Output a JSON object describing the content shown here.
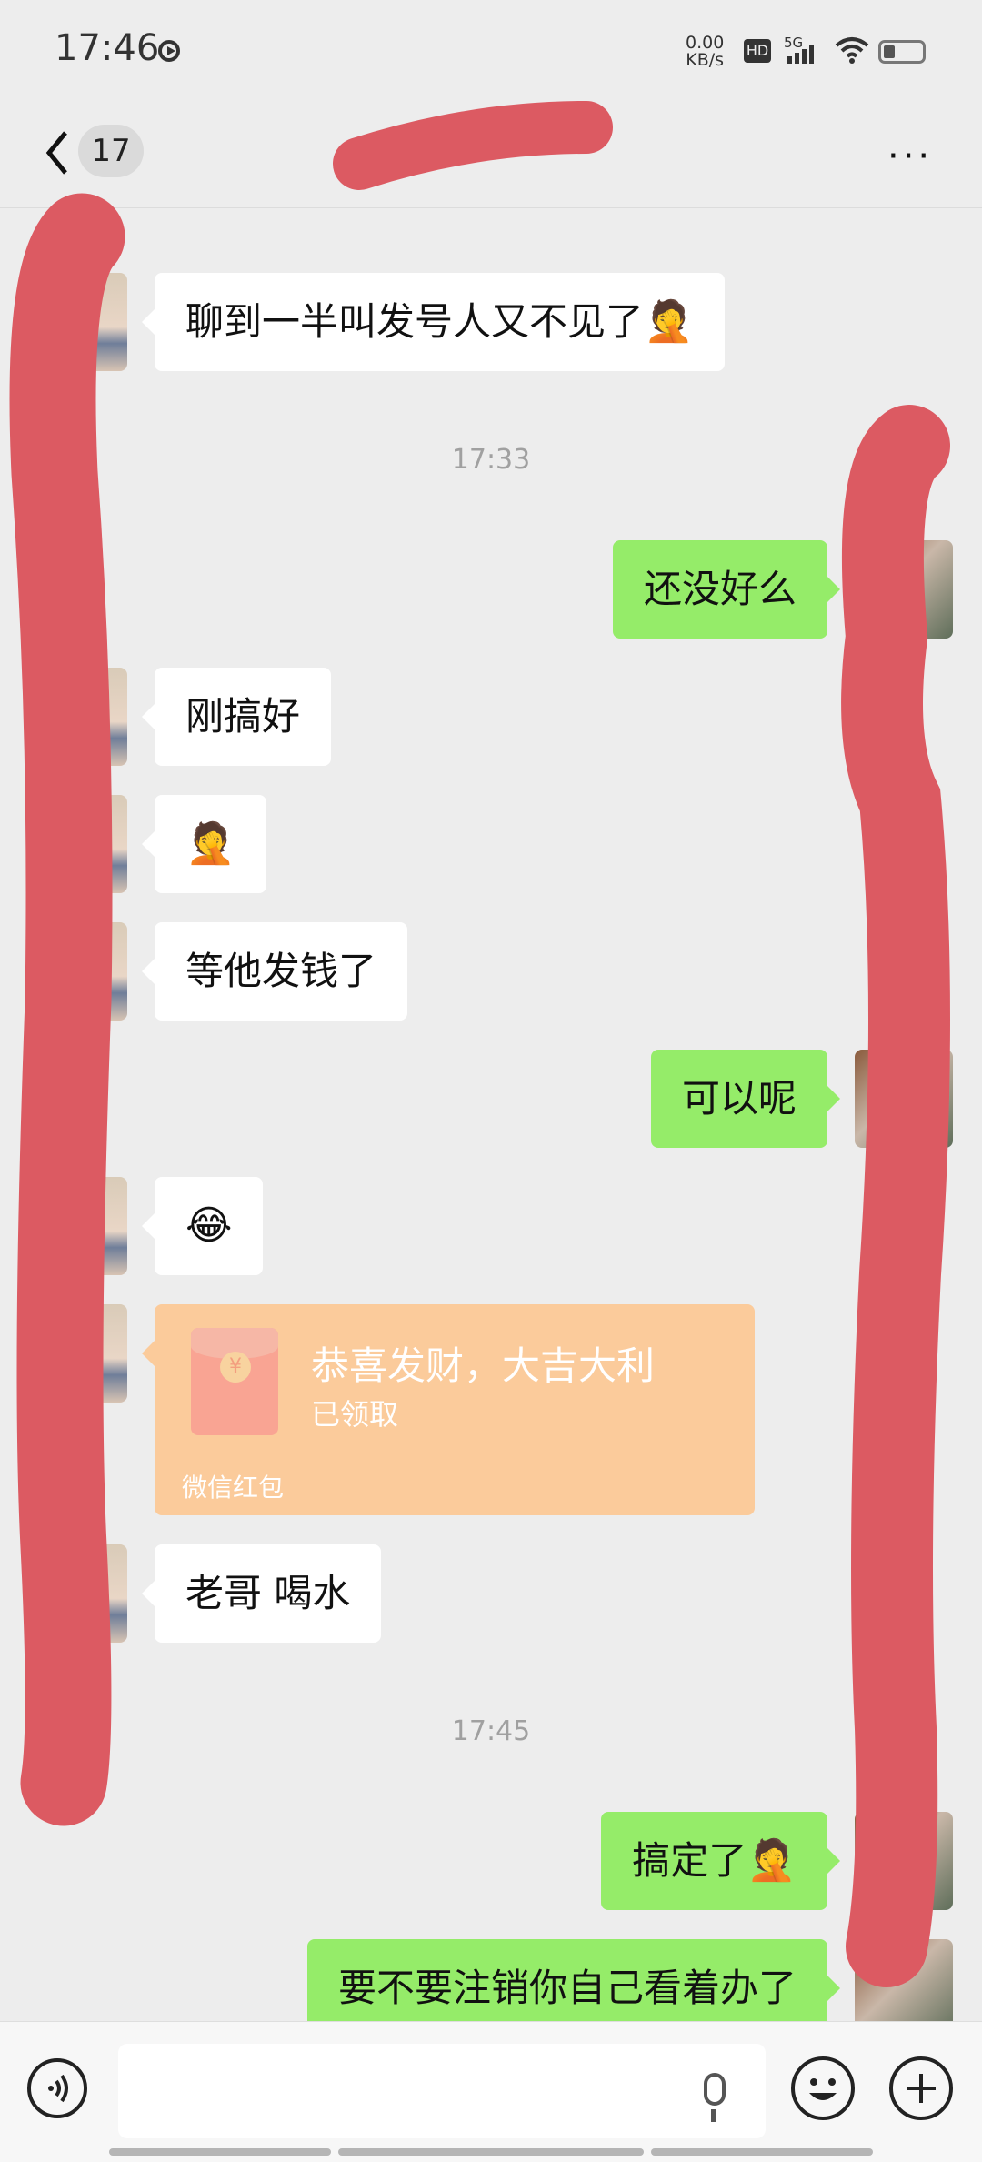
{
  "status_bar": {
    "time": "17:46",
    "net_speed_value": "0.00",
    "net_speed_unit": "KB/s",
    "hd_label": "HD",
    "signal_label": "5G"
  },
  "title_bar": {
    "unread_count": "17"
  },
  "messages": [
    {
      "text": "聊到一半叫发号人又不见了",
      "emoji": "🤦"
    },
    {
      "text": "17:33"
    },
    {
      "text": "还没好么"
    },
    {
      "text": "刚搞好"
    },
    {
      "text": "",
      "emoji": "🤦"
    },
    {
      "text": "等他发钱了"
    },
    {
      "text": "可以呢"
    },
    {
      "text": "",
      "emoji": "😂"
    },
    {
      "text": "老哥 喝水"
    },
    {
      "text": "17:45"
    },
    {
      "text": "搞定了",
      "emoji": "🤦"
    },
    {
      "text": "要不要注销你自己看着办了"
    }
  ],
  "red_packet": {
    "title": "恭喜发财，大吉大利",
    "status": "已领取",
    "label": "微信红包",
    "coin_symbol": "¥"
  },
  "colors": {
    "background": "#ededed",
    "sent_bubble": "#95ec69",
    "received_bubble": "#ffffff",
    "red_packet": "#fbcb9b",
    "redaction": "#dc5a62"
  }
}
